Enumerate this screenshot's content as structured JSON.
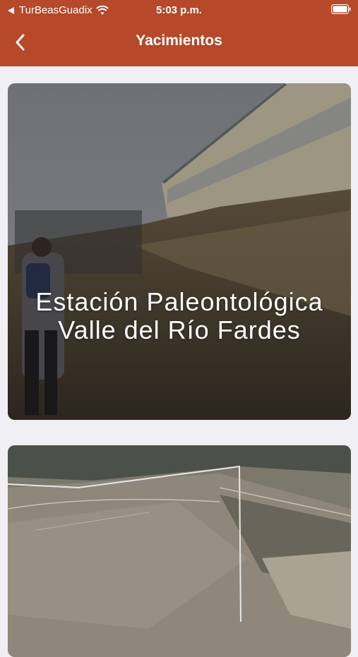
{
  "status_bar": {
    "carrier": "TurBeasGuadix",
    "time": "5:03 p.m."
  },
  "nav": {
    "title": "Yacimientos",
    "back_icon": "chevron-left-icon"
  },
  "cards": [
    {
      "title": "Estación Paleontológica Valle del Río Fardes"
    },
    {
      "title": ""
    }
  ],
  "colors": {
    "header": "#b5492a",
    "background": "#efeff4"
  }
}
